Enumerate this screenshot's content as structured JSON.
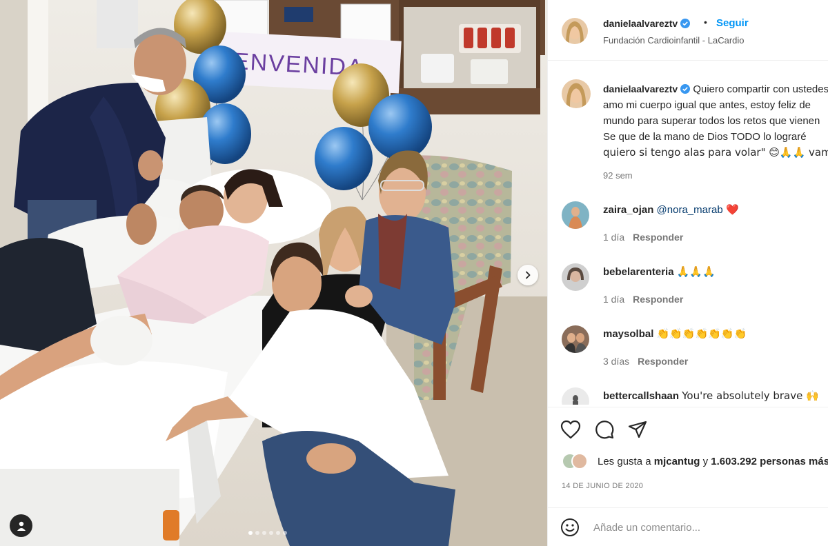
{
  "post": {
    "author": "danielaalvareztv",
    "follow_label": "Seguir",
    "separator": "•",
    "location": "Fundación Cardioinfantil - LaCardio",
    "banner_text": "BIENVENIDA",
    "carousel": {
      "total": 6,
      "active": 1
    }
  },
  "caption": {
    "username": "danielaalvareztv",
    "lines": [
      "Quiero compartir con ustedes",
      "amo mi cuerpo igual que antes, estoy feliz de",
      "mundo para superar todos los retos que vienen",
      "Se que de la mano de Dios TODO lo lograré",
      "quiero si tengo alas para volar\" 😊🙏🙏 vamos"
    ],
    "time": "92 sem"
  },
  "comments": [
    {
      "username": "zaira_ojan",
      "mention": "@nora_marab",
      "text": " ❤️",
      "time": "1 día",
      "reply_label": "Responder"
    },
    {
      "username": "bebelarenteria",
      "mention": "",
      "text": "🙏🙏🙏",
      "time": "1 día",
      "reply_label": "Responder"
    },
    {
      "username": "maysolbal",
      "mention": "",
      "text": "👏👏👏👏👏👏👏",
      "time": "3 días",
      "reply_label": "Responder"
    },
    {
      "username": "bettercallshaan",
      "mention": "",
      "text": "You're absolutely brave 🙌",
      "time": "",
      "reply_label": ""
    }
  ],
  "likes": {
    "prefix": "Les gusta a",
    "user": "mjcantug",
    "connector": "y",
    "count": "1.603.292 personas más"
  },
  "date": "14 DE JUNIO DE 2020",
  "comment_box": {
    "placeholder": "Añade un comentario..."
  },
  "colors": {
    "accent": "#0095f6",
    "verified": "#3897f0",
    "heart": "#ed4956",
    "balloon_blue": "#2e78c7",
    "balloon_gold": "#c9a54a"
  },
  "icons": {
    "like": "heart-outline-icon",
    "comment": "speech-bubble-icon",
    "share": "paper-plane-icon",
    "next": "chevron-right-icon",
    "tags": "user-tag-icon",
    "emoji": "smiley-icon"
  }
}
